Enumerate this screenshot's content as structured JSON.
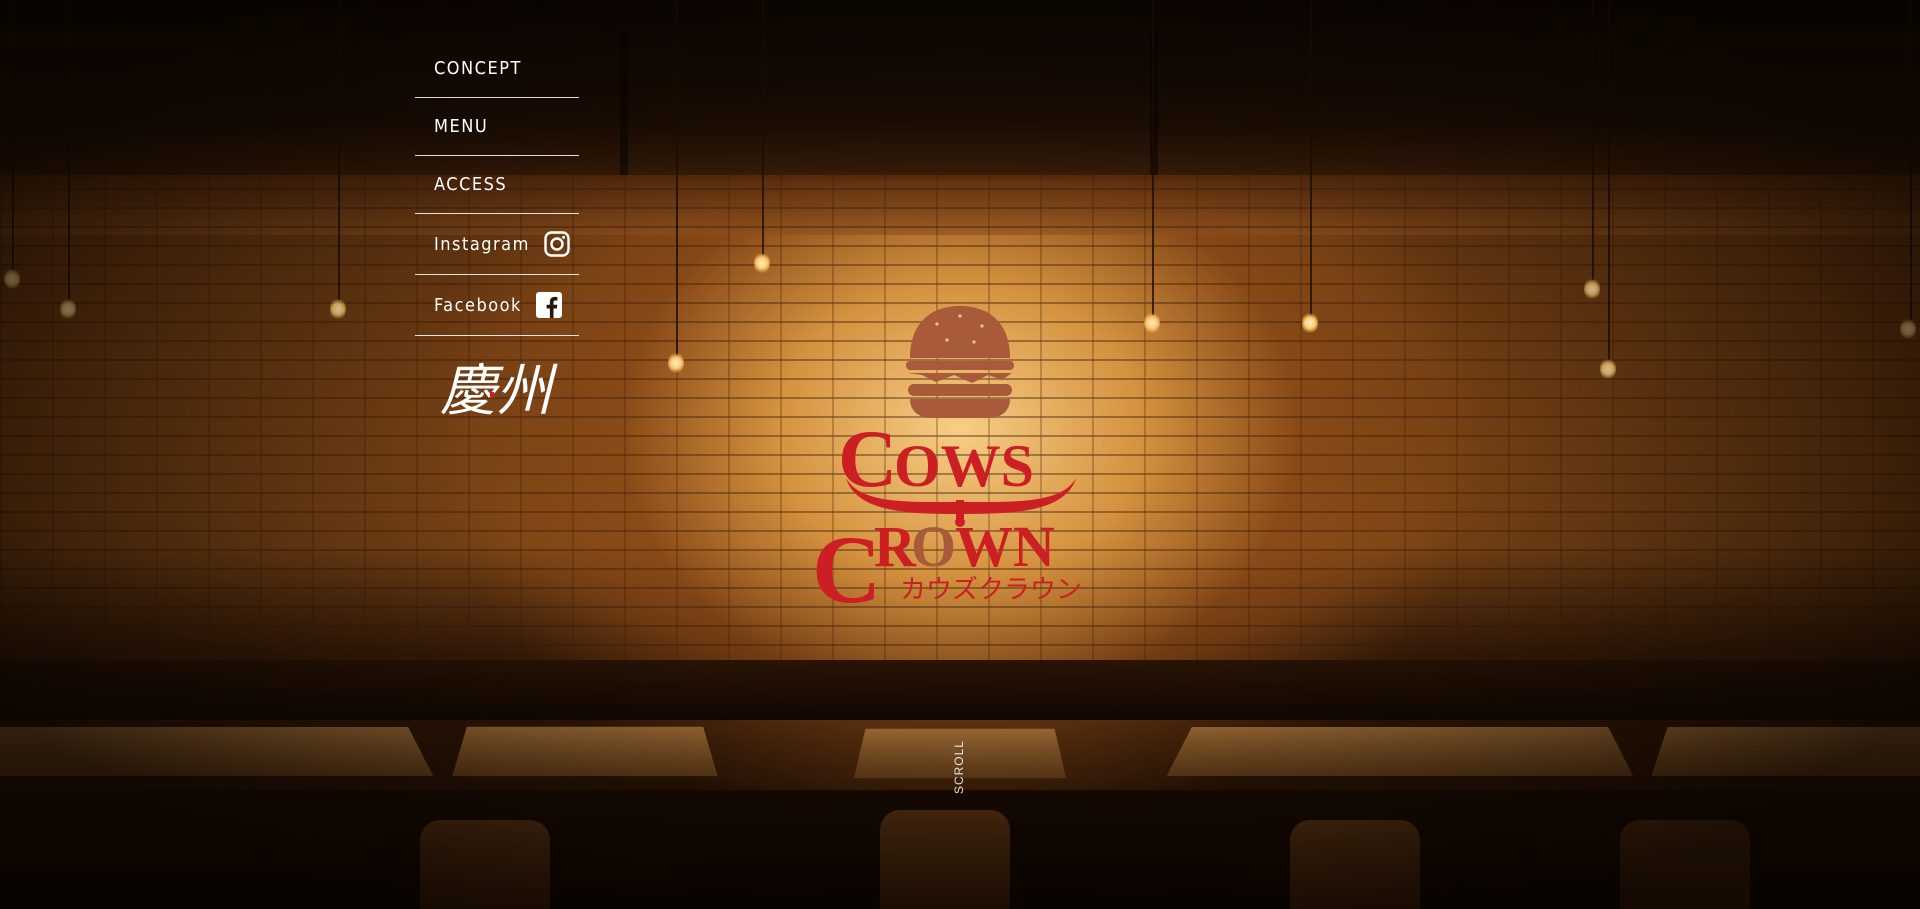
{
  "nav": {
    "items": [
      {
        "label": "CONCEPT"
      },
      {
        "label": "MENU"
      },
      {
        "label": "ACCESS"
      },
      {
        "label": "Instagram",
        "icon": "instagram-icon"
      },
      {
        "label": "Facebook",
        "icon": "facebook-icon"
      }
    ]
  },
  "partner_logo": {
    "text": "慶州"
  },
  "brand": {
    "line1": "COWS",
    "line2": "CROWN",
    "katakana": "カウズクラウン"
  },
  "scroll": {
    "label": "SCROLL"
  },
  "colors": {
    "brand_red": "#cc1f24",
    "bun_brown": "#a85a3a",
    "nav_text": "#ffffff"
  }
}
